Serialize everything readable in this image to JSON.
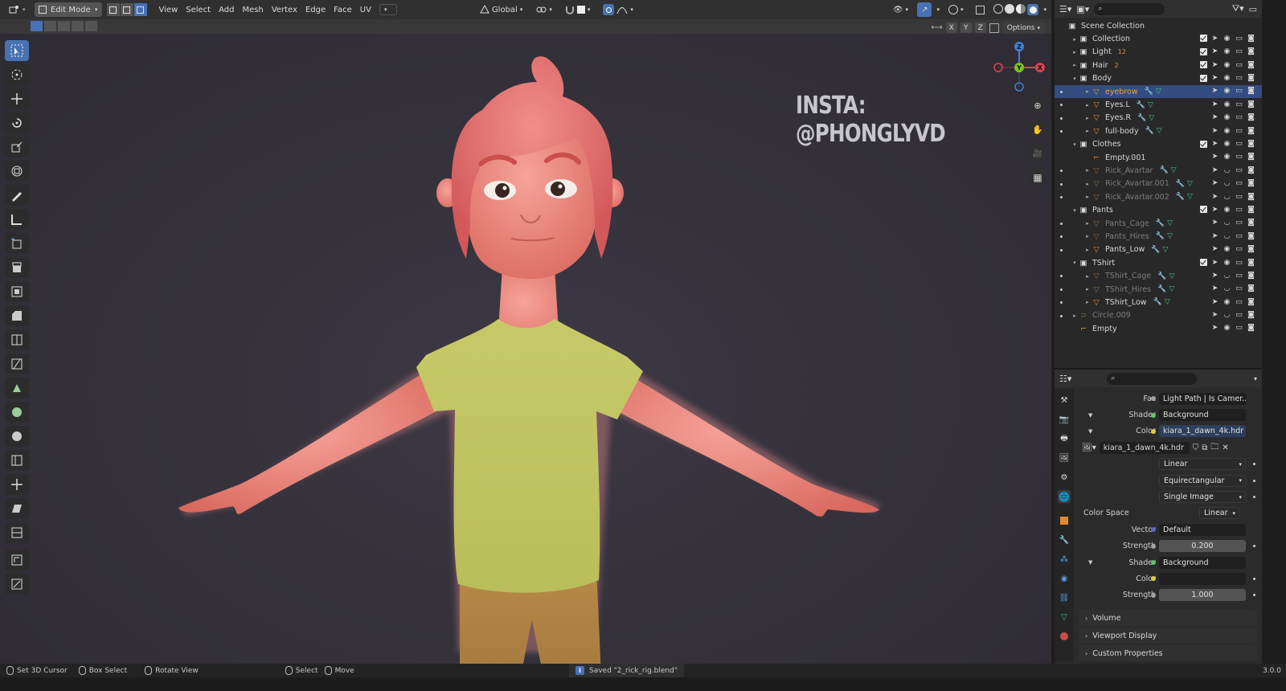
{
  "viewport": {
    "mode": "Edit Mode",
    "menus": [
      "View",
      "Select",
      "Add",
      "Mesh",
      "Vertex",
      "Edge",
      "Face",
      "UV"
    ],
    "transform_orientation": "Global",
    "axis_buttons": [
      "X",
      "Y",
      "Z"
    ],
    "options_label": "Options",
    "watermark": "INSTA: @PHONGLYVD",
    "gizmo_axes": {
      "x": "X",
      "y": "Y",
      "z": "Z"
    },
    "colors": {
      "x": "#e0404f",
      "y": "#7ec21c",
      "z": "#3e80d6",
      "active": "#4772b3"
    }
  },
  "status": {
    "items": [
      "Set 3D Cursor",
      "Box Select",
      "Rotate View",
      "Select",
      "Move"
    ],
    "message": "Saved \"2_rick_rig.blend\"",
    "version": "3.0.0"
  },
  "outliner": {
    "search_placeholder": "",
    "root": "Scene Collection",
    "rows": [
      {
        "name": "Collection",
        "type": "collection"
      },
      {
        "name": "Light",
        "type": "collection",
        "extra": "12"
      },
      {
        "name": "Hair",
        "type": "collection",
        "extra": "2"
      },
      {
        "name": "Body",
        "type": "collection"
      },
      {
        "name": "eyebrow",
        "type": "mesh"
      },
      {
        "name": "Eyes.L",
        "type": "mesh"
      },
      {
        "name": "Eyes.R",
        "type": "mesh"
      },
      {
        "name": "full-body",
        "type": "mesh"
      },
      {
        "name": "Clothes",
        "type": "collection"
      },
      {
        "name": "Empty.001",
        "type": "empty"
      },
      {
        "name": "Rick_Avartar",
        "type": "mesh"
      },
      {
        "name": "Rick_Avartar.001",
        "type": "mesh"
      },
      {
        "name": "Rick_Avartar.002",
        "type": "mesh"
      },
      {
        "name": "Pants",
        "type": "collection"
      },
      {
        "name": "Pants_Cage",
        "type": "mesh"
      },
      {
        "name": "Pants_Hires",
        "type": "mesh"
      },
      {
        "name": "Pants_Low",
        "type": "mesh"
      },
      {
        "name": "TShirt",
        "type": "collection"
      },
      {
        "name": "TShirt_Cage",
        "type": "mesh"
      },
      {
        "name": "TShirt_Hires",
        "type": "mesh"
      },
      {
        "name": "TShirt_Low",
        "type": "mesh"
      },
      {
        "name": "Circle.009",
        "type": "curve"
      },
      {
        "name": "Empty",
        "type": "empty"
      }
    ]
  },
  "properties": {
    "search_placeholder": "",
    "fac_label": "Fac",
    "fac_value": "Light Path | Is Camer...",
    "shader1_label": "Shader",
    "shader1_value": "Background",
    "color1_label": "Color",
    "color1_value": "kiara_1_dawn_4k.hdr",
    "image_name": "kiara_1_dawn_4k.hdr",
    "interpolation": "Linear",
    "projection": "Equirectangular",
    "source": "Single Image",
    "colorspace_label": "Color Space",
    "colorspace_value": "Linear",
    "vector_label": "Vector",
    "vector_value": "Default",
    "strength1_label": "Strength",
    "strength1_value": "0.200",
    "shader2_label": "Shader",
    "shader2_value": "Background",
    "color2_label": "Color",
    "strength2_label": "Strength",
    "strength2_value": "1.000",
    "panels": [
      "Volume",
      "Viewport Display",
      "Custom Properties"
    ]
  }
}
